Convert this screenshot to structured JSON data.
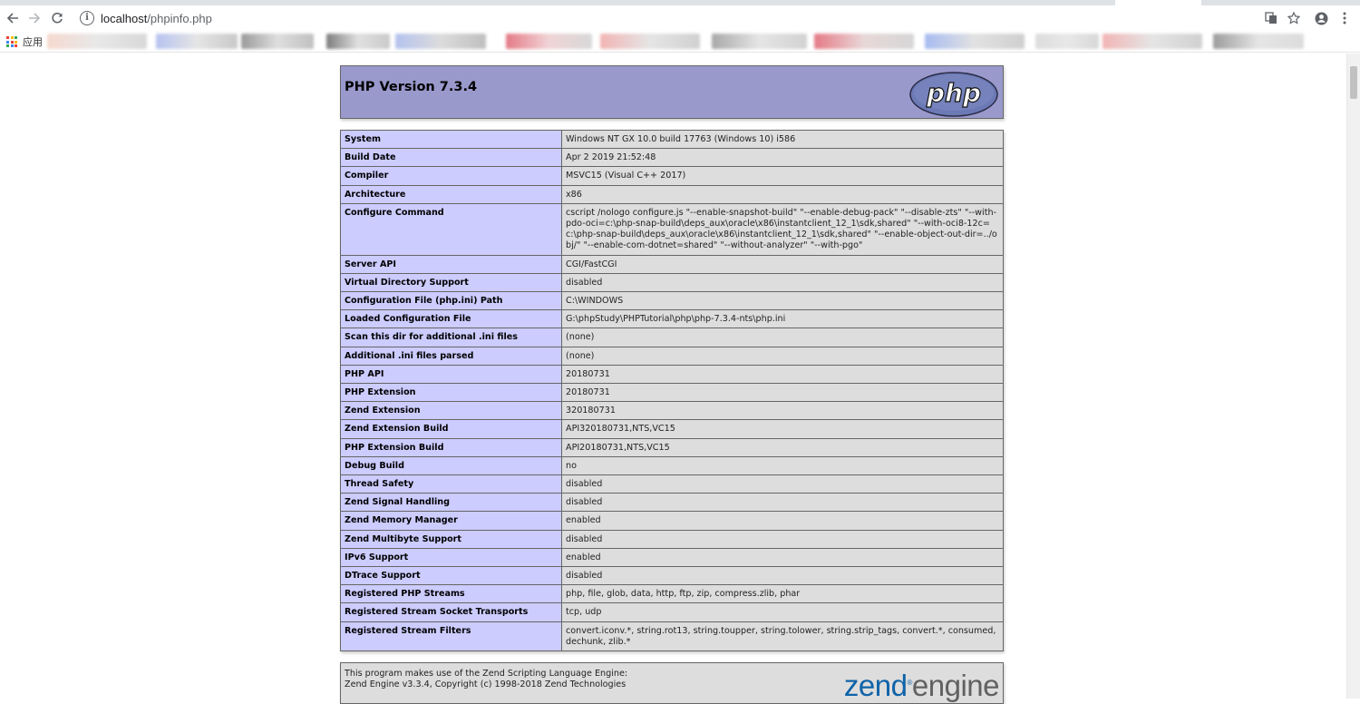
{
  "browser": {
    "url_host": "localhost",
    "url_path": "/phpinfo.php",
    "bookmarks_apps_label": "应用",
    "icons": [
      "back-icon",
      "forward-icon",
      "reload-icon",
      "info-icon",
      "translate-icon",
      "star-icon",
      "account-icon",
      "menu-icon",
      "apps-icon"
    ]
  },
  "php_header": {
    "title": "PHP Version 7.3.4",
    "logo_text": "php",
    "logo_color": "#5b6ba8"
  },
  "info_table": [
    {
      "label": "System",
      "value": "Windows NT GX 10.0 build 17763 (Windows 10) i586"
    },
    {
      "label": "Build Date",
      "value": "Apr 2 2019 21:52:48"
    },
    {
      "label": "Compiler",
      "value": "MSVC15 (Visual C++ 2017)"
    },
    {
      "label": "Architecture",
      "value": "x86"
    },
    {
      "label": "Configure Command",
      "value": "cscript /nologo configure.js \"--enable-snapshot-build\" \"--enable-debug-pack\" \"--disable-zts\" \"--with-pdo-oci=c:\\php-snap-build\\deps_aux\\oracle\\x86\\instantclient_12_1\\sdk,shared\" \"--with-oci8-12c=c:\\php-snap-build\\deps_aux\\oracle\\x86\\instantclient_12_1\\sdk,shared\" \"--enable-object-out-dir=../obj/\" \"--enable-com-dotnet=shared\" \"--without-analyzer\" \"--with-pgo\""
    },
    {
      "label": "Server API",
      "value": "CGI/FastCGI"
    },
    {
      "label": "Virtual Directory Support",
      "value": "disabled"
    },
    {
      "label": "Configuration File (php.ini) Path",
      "value": "C:\\WINDOWS"
    },
    {
      "label": "Loaded Configuration File",
      "value": "G:\\phpStudy\\PHPTutorial\\php\\php-7.3.4-nts\\php.ini"
    },
    {
      "label": "Scan this dir for additional .ini files",
      "value": "(none)"
    },
    {
      "label": "Additional .ini files parsed",
      "value": "(none)"
    },
    {
      "label": "PHP API",
      "value": "20180731"
    },
    {
      "label": "PHP Extension",
      "value": "20180731"
    },
    {
      "label": "Zend Extension",
      "value": "320180731"
    },
    {
      "label": "Zend Extension Build",
      "value": "API320180731,NTS,VC15"
    },
    {
      "label": "PHP Extension Build",
      "value": "API20180731,NTS,VC15"
    },
    {
      "label": "Debug Build",
      "value": "no"
    },
    {
      "label": "Thread Safety",
      "value": "disabled"
    },
    {
      "label": "Zend Signal Handling",
      "value": "disabled"
    },
    {
      "label": "Zend Memory Manager",
      "value": "enabled"
    },
    {
      "label": "Zend Multibyte Support",
      "value": "disabled"
    },
    {
      "label": "IPv6 Support",
      "value": "enabled"
    },
    {
      "label": "DTrace Support",
      "value": "disabled"
    },
    {
      "label": "Registered PHP Streams",
      "value": "php, file, glob, data, http, ftp, zip, compress.zlib, phar"
    },
    {
      "label": "Registered Stream Socket Transports",
      "value": "tcp, udp"
    },
    {
      "label": "Registered Stream Filters",
      "value": "convert.iconv.*, string.rot13, string.toupper, string.tolower, string.strip_tags, convert.*, consumed, dechunk, zlib.*"
    }
  ],
  "zend_box": {
    "line1": "This program makes use of the Zend Scripting Language Engine:",
    "line2": "Zend Engine v3.3.4, Copyright (c) 1998-2018 Zend Technologies",
    "logo_zend": "zend",
    "logo_engine": "engine",
    "logo_reg": "®"
  },
  "colors": {
    "header_bg": "#9999cc",
    "label_bg": "#ccccff",
    "value_bg": "#dddddd",
    "border": "#666666"
  }
}
